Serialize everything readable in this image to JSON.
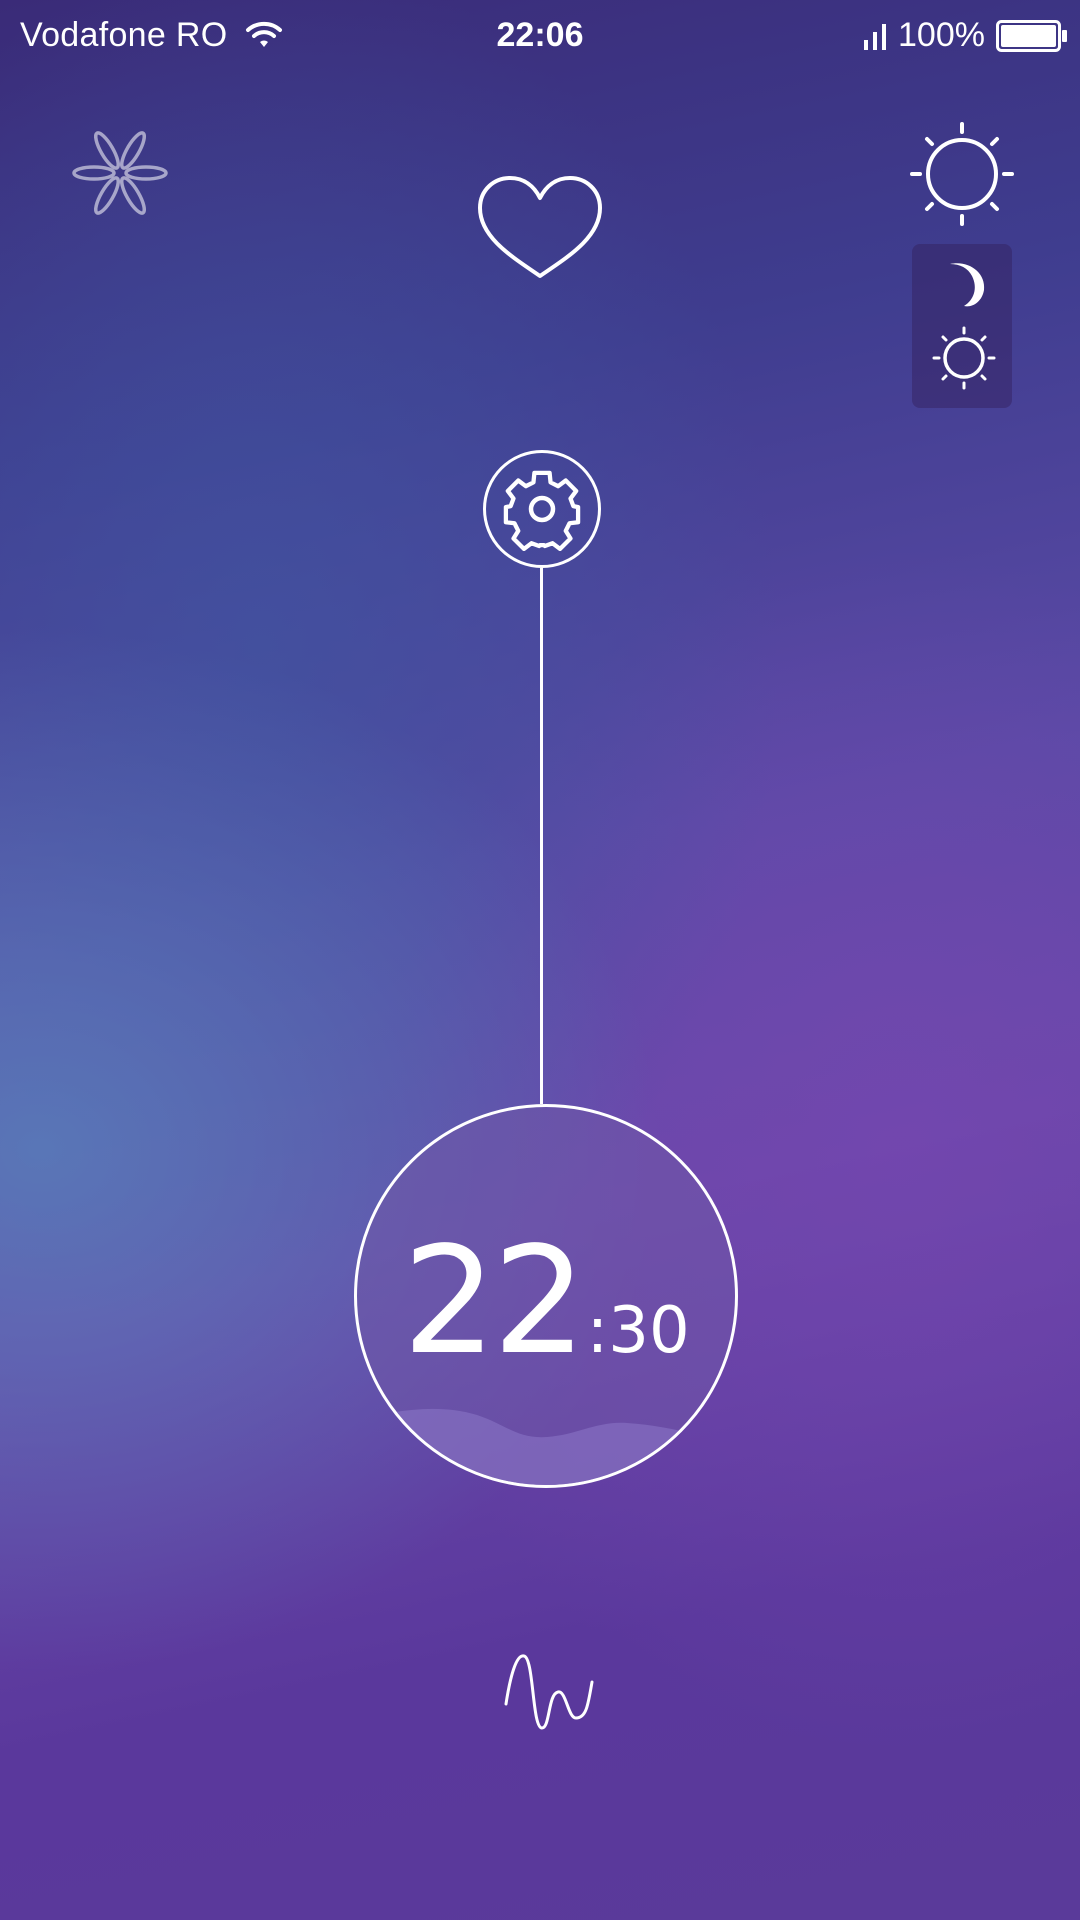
{
  "status_bar": {
    "carrier": "Vodafone RO",
    "time": "22:06",
    "battery_percent": "100%",
    "battery_level": 1.0,
    "icons": [
      "wifi-icon",
      "signal-icon",
      "battery-icon"
    ]
  },
  "top_icons": {
    "left": "flower-icon",
    "center": "heart-icon",
    "right": "sun-icon"
  },
  "mode_panel": {
    "items": [
      "moon-icon",
      "sun-icon"
    ]
  },
  "settings": {
    "icon": "gear-icon"
  },
  "time_dial": {
    "hours": "22",
    "separator": ":",
    "minutes": "30"
  },
  "bottom": {
    "icon": "wave-icon"
  },
  "colors": {
    "background_top": "#3a2b78",
    "background_mid": "#6a48aa",
    "accent_blue": "#587eba",
    "foreground": "#ffffff"
  }
}
